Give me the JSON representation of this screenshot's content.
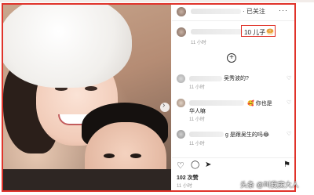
{
  "header": {
    "follow_label": "· 已关注",
    "more_label": "···"
  },
  "caption": {
    "text": "10 儿子",
    "emoji": "🥯",
    "time": "11 小时"
  },
  "add_comment_symbol": "+",
  "comments": [
    {
      "text": "吴秀波的?",
      "time": "11 小时"
    },
    {
      "text": "🥰 你也是",
      "second_line": "华人嘛",
      "time": "11 小时"
    },
    {
      "text": "g 是跟吴生的吗😂",
      "time": "11 小时"
    }
  ],
  "actions": {
    "like_icon": "♡",
    "comment_icon": "◯",
    "share_icon": "➤",
    "save_icon": "⚑"
  },
  "likes_text": "102 次赞",
  "post_time": "11 小时",
  "watermark": "头条 @叫我窦大人",
  "colors": {
    "highlight": "#e0332a"
  }
}
